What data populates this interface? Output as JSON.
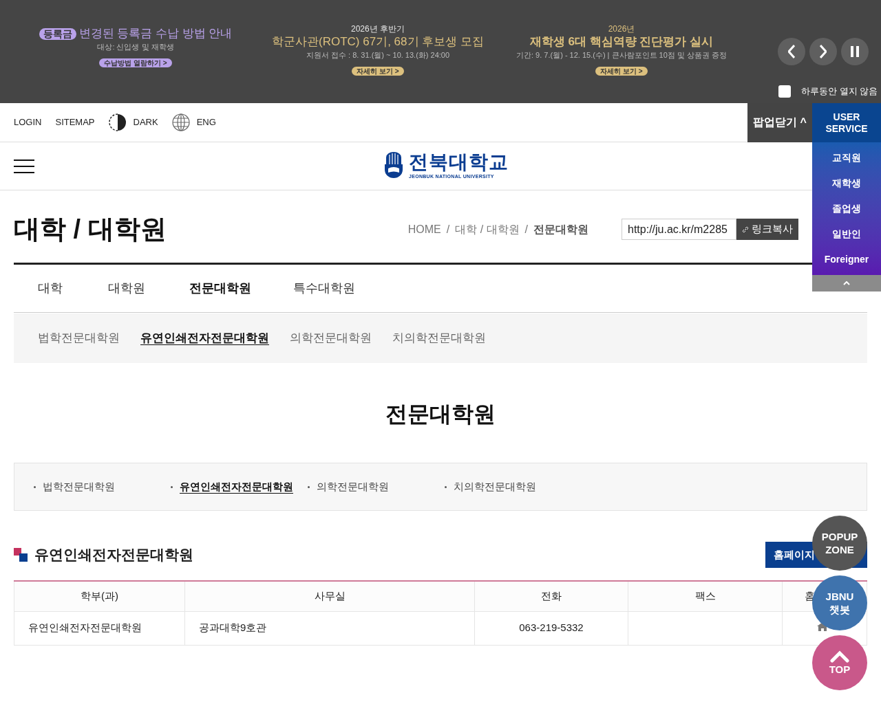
{
  "banner": {
    "slides": [
      {
        "badge": "등록금",
        "title": "변경된 등록금 수납 방법 안내",
        "subtitle": "대상: 신입생 및 재학생",
        "button": "수납방법 열람하기 >",
        "color": "#b9a2ea"
      },
      {
        "kicker": "2026년 후반기",
        "title": "학군사관(ROTC) 67기, 68기 후보생 모집",
        "subtitle": "지원서 접수 : 8. 31.(월) ~ 10. 13.(화) 24:00",
        "button": "자세히 보기 >",
        "color": "#dcc07e"
      },
      {
        "kicker": "2026년",
        "title": "재학생 6대 핵심역량 진단평가 실시",
        "subtitle": "기간: 9. 7.(월) - 12. 15.(수) | 큰사람포인트 10점 및 상품권 증정",
        "button": "자세히 보기 >",
        "color": "#dcc07e"
      }
    ],
    "hide_today": {
      "label": "하루동안 열지 않음",
      "checked": false
    }
  },
  "utility_bar": {
    "items": [
      {
        "kind": "link",
        "label": "LOGIN"
      },
      {
        "kind": "link",
        "label": "SITEMAP"
      },
      {
        "kind": "dark",
        "label": "DARK"
      },
      {
        "kind": "lang",
        "label": "ENG"
      }
    ],
    "popup_close": "팝업닫기 ^"
  },
  "user_service": {
    "title": "USER SERVICE",
    "items": [
      "교직원",
      "재학생",
      "졸업생",
      "일반인",
      "Foreigner"
    ]
  },
  "logo": {
    "name": "전북대학교",
    "english": "JEONBUK NATIONAL UNIVERSITY"
  },
  "page_title": "대학 / 대학원",
  "breadcrumb": [
    "HOME",
    "/",
    "대학 / 대학원",
    "/",
    "전문대학원"
  ],
  "url_field": "http://ju.ac.kr/m2285",
  "copy_button": "링크복사",
  "tabs": [
    {
      "label": "대학",
      "selected": false
    },
    {
      "label": "대학원",
      "selected": false
    },
    {
      "label": "전문대학원",
      "selected": true
    },
    {
      "label": "특수대학원",
      "selected": false
    }
  ],
  "subtabs": [
    {
      "label": "법학전문대학원",
      "selected": false
    },
    {
      "label": "유연인쇄전자전문대학원",
      "selected": true
    },
    {
      "label": "의학전문대학원",
      "selected": false
    },
    {
      "label": "치의학전문대학원",
      "selected": false
    }
  ],
  "content_title": "전문대학원",
  "quick_links": [
    {
      "label": "법학전문대학원",
      "selected": false
    },
    {
      "label": "유연인쇄전자전문대학원",
      "selected": true
    },
    {
      "label": "의학전문대학원",
      "selected": false
    },
    {
      "label": "치의학전문대학원",
      "selected": false
    }
  ],
  "section": {
    "title": "유연인쇄전자전문대학원",
    "homepage_button": "홈페이지"
  },
  "table": {
    "columns": [
      "학부(과)",
      "사무실",
      "전화",
      "팩스",
      "홈"
    ],
    "rows": [
      {
        "cells": [
          "유연인쇄전자전문대학원",
          "공과대학9호관",
          "063-219-5332",
          ""
        ],
        "homepage_link": true
      }
    ]
  },
  "floating": {
    "popup_zone": "POPUP ZONE",
    "chatbot": "JBNU 챗봇",
    "top": "TOP"
  }
}
